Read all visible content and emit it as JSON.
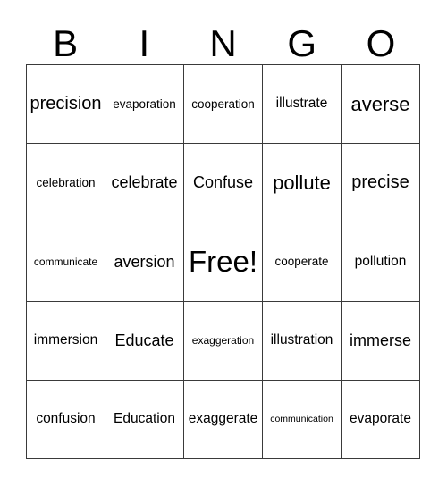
{
  "card": {
    "title": "BINGO",
    "header_letters": [
      "B",
      "I",
      "N",
      "G",
      "O"
    ],
    "grid_size": 5,
    "free_space": {
      "row": 2,
      "col": 2,
      "label": "Free!"
    },
    "colors": {
      "background": "#ffffff",
      "text": "#000000",
      "grid_line": "#3a3a3a"
    },
    "rows": [
      [
        {
          "label": "precision",
          "size": "xl"
        },
        {
          "label": "evaporation",
          "size": "s"
        },
        {
          "label": "cooperation",
          "size": "s"
        },
        {
          "label": "illustrate",
          "size": "m"
        },
        {
          "label": "averse",
          "size": "xxl"
        }
      ],
      [
        {
          "label": "celebration",
          "size": "s"
        },
        {
          "label": "celebrate",
          "size": "l"
        },
        {
          "label": "Confuse",
          "size": "l"
        },
        {
          "label": "pollute",
          "size": "xxl"
        },
        {
          "label": "precise",
          "size": "xl"
        }
      ],
      [
        {
          "label": "communicate",
          "size": "xs"
        },
        {
          "label": "aversion",
          "size": "l"
        },
        {
          "label": "Free!",
          "size": "free"
        },
        {
          "label": "cooperate",
          "size": "s"
        },
        {
          "label": "pollution",
          "size": "m"
        }
      ],
      [
        {
          "label": "immersion",
          "size": "m"
        },
        {
          "label": "Educate",
          "size": "l"
        },
        {
          "label": "exaggeration",
          "size": "xs"
        },
        {
          "label": "illustration",
          "size": "m"
        },
        {
          "label": "immerse",
          "size": "l"
        }
      ],
      [
        {
          "label": "confusion",
          "size": "m"
        },
        {
          "label": "Education",
          "size": "m"
        },
        {
          "label": "exaggerate",
          "size": "m"
        },
        {
          "label": "communication",
          "size": "xxs"
        },
        {
          "label": "evaporate",
          "size": "m"
        }
      ]
    ]
  }
}
